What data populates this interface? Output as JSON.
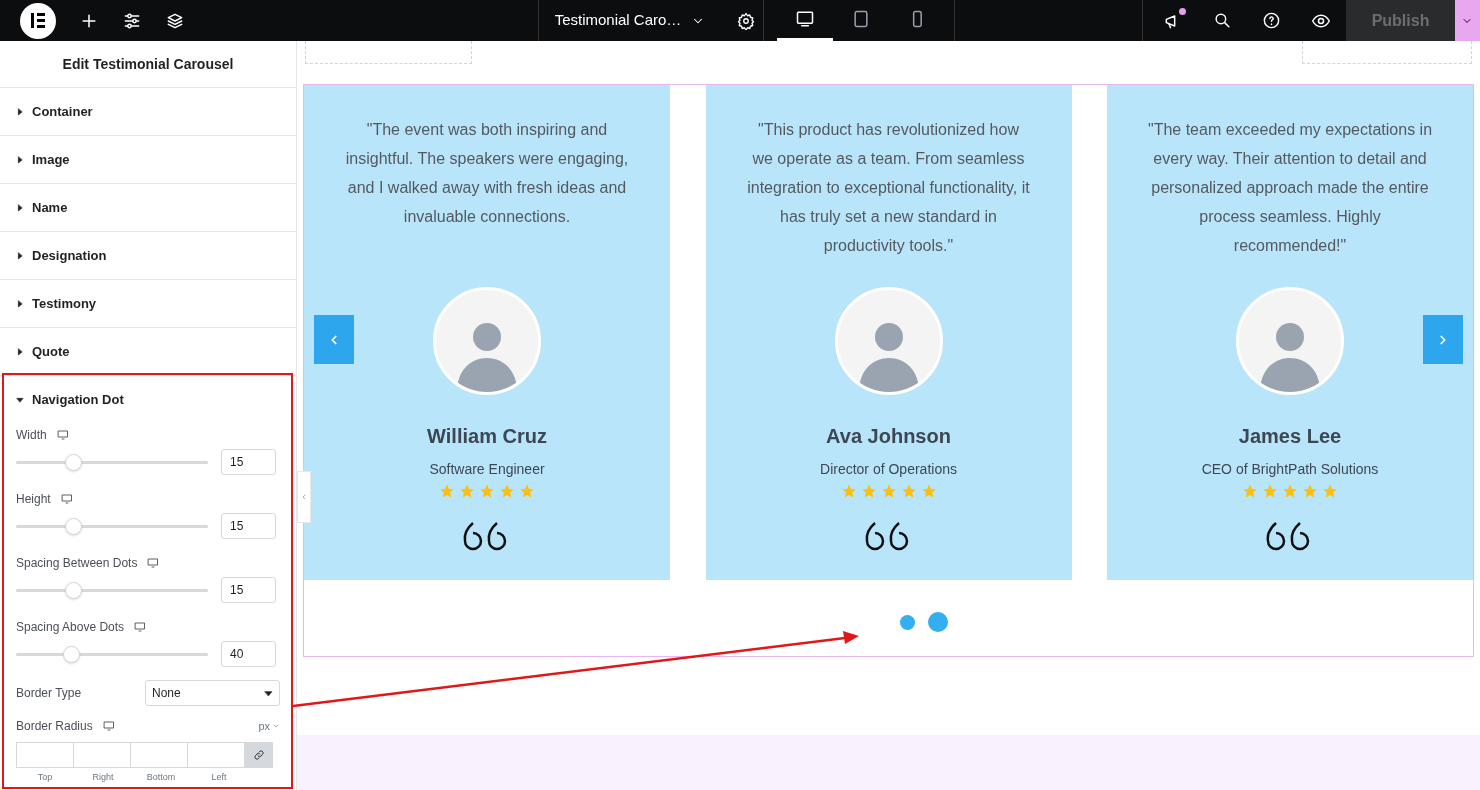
{
  "topbar": {
    "page_title": "Testimonial Caro…",
    "publish": "Publish",
    "devices": [
      {
        "kind": "desktop",
        "selected": true
      },
      {
        "kind": "tablet",
        "selected": false
      },
      {
        "kind": "mobile",
        "selected": false
      }
    ]
  },
  "panel": {
    "title": "Edit Testimonial Carousel",
    "sections": [
      {
        "label": "Container",
        "expanded": false
      },
      {
        "label": "Image",
        "expanded": false
      },
      {
        "label": "Name",
        "expanded": false
      },
      {
        "label": "Designation",
        "expanded": false
      },
      {
        "label": "Testimony",
        "expanded": false
      },
      {
        "label": "Quote",
        "expanded": false
      },
      {
        "label": "Navigation Dot",
        "expanded": true
      }
    ],
    "sliders": [
      {
        "label": "Width",
        "value": "15",
        "level": 0.28
      },
      {
        "label": "Height",
        "value": "15",
        "level": 0.28
      },
      {
        "label": "Spacing Between Dots",
        "value": "15",
        "level": 0.28
      },
      {
        "label": "Spacing Above Dots",
        "value": "40",
        "level": 0.27
      }
    ],
    "border_type": {
      "label": "Border Type",
      "value": "None"
    },
    "border_radius": {
      "label": "Border Radius",
      "unit": "px",
      "sides": [
        "Top",
        "Right",
        "Bottom",
        "Left"
      ]
    }
  },
  "carousel": {
    "cards": [
      {
        "quote": "\"The event was both inspiring and insightful. The speakers were engaging, and I walked away with fresh ideas and invaluable connections.",
        "name": "William Cruz",
        "role": "Software Engineer",
        "stars": 5
      },
      {
        "quote": "\"This product has revolutionized how we operate as a team. From seamless integration to exceptional functionality, it has truly set a new standard in productivity tools.\"",
        "name": "Ava Johnson",
        "role": "Director of Operations",
        "stars": 5
      },
      {
        "quote": "\"The team exceeded my expectations in every way. Their attention to detail and personalized approach made the entire process seamless. Highly recommended!\"",
        "name": "James Lee",
        "role": "CEO of BrightPath Solutions",
        "stars": 5
      }
    ],
    "dots": [
      {
        "selected": false
      },
      {
        "selected": true
      }
    ]
  }
}
